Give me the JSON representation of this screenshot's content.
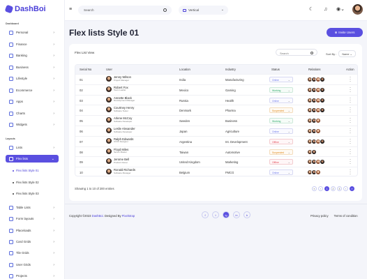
{
  "brand": {
    "name": "DashBoi"
  },
  "sidebar": {
    "section_dashboard": "Dashboard",
    "section_layouts": "Layouts",
    "items_top": [
      "Personal",
      "Finance",
      "Banking",
      "Business",
      "Lifestyle",
      "Ecommerce",
      "Apps",
      "Charts",
      "Widgets"
    ],
    "items_layout": [
      "Lists",
      "Flex lists",
      "Table Lists",
      "Form layouts",
      "Placeloads",
      "Card Grids",
      "Tile Grids",
      "User Grids",
      "Projects"
    ],
    "sub_items": [
      "Flex lists Style 01",
      "Flex lists Style 02",
      "Flex lists Style 03"
    ]
  },
  "topbar": {
    "search_placeholder": "Search",
    "layout_value": "Vertical"
  },
  "page": {
    "title": "Flex lists Style 01",
    "invite_label": "Invite Users"
  },
  "card": {
    "title": "Flex List View",
    "search_placeholder": "Search",
    "sort_label": "Sort By :",
    "sort_value": "Name"
  },
  "table": {
    "headers": [
      "Serial No",
      "User",
      "Location",
      "Industry",
      "Status",
      "Relations",
      "Action"
    ],
    "rows": [
      {
        "serial": "01",
        "name": "Jenny Wilson",
        "role": "Project Manager",
        "location": "India",
        "industry": "Manufacturing",
        "status": "Online",
        "status_type": "online"
      },
      {
        "serial": "02",
        "name": "Robert Fox",
        "role": "Team Leader",
        "location": "Mexico",
        "industry": "Gaming",
        "status": "Working",
        "status_type": "working"
      },
      {
        "serial": "03",
        "name": "Annette Black",
        "role": "Development Manager",
        "location": "Russia",
        "industry": "Health",
        "status": "Online",
        "status_type": "online"
      },
      {
        "serial": "04",
        "name": "Courtney Henry",
        "role": "Software Tester",
        "location": "Denmark",
        "industry": "Pharma",
        "status": "Suspended",
        "status_type": "suspended"
      },
      {
        "serial": "05",
        "name": "Arlene McCoy",
        "role": "Software Developer",
        "location": "Sweden",
        "industry": "Business",
        "status": "Working",
        "status_type": "working"
      },
      {
        "serial": "06",
        "name": "Leslie Alexander",
        "role": "Software Developer",
        "location": "Japan",
        "industry": "Agriculture",
        "status": "Online",
        "status_type": "online"
      },
      {
        "serial": "07",
        "name": "Ralph Edwards",
        "role": "UI/UX Designer",
        "location": "Argentina",
        "industry": "Int. Development",
        "status": "Offline",
        "status_type": "offline"
      },
      {
        "serial": "08",
        "name": "Floyd Miles",
        "role": "Server Master",
        "location": "Taiwan",
        "industry": "Automotive",
        "status": "Suspended",
        "status_type": "suspended"
      },
      {
        "serial": "09",
        "name": "Jerome Bell",
        "role": "Product Owner",
        "location": "United Kingdom",
        "industry": "Marketing",
        "status": "Offline",
        "status_type": "offline"
      },
      {
        "serial": "10",
        "name": "Ronald Richards",
        "role": "Software Manager",
        "location": "Belgium",
        "industry": "FMCG",
        "status": "Online",
        "status_type": "online"
      }
    ],
    "relations_counts": [
      4,
      4,
      4,
      4,
      3,
      3,
      4,
      2,
      4,
      3
    ],
    "showing": "Showing 1 to 10 of 200 entries",
    "pagination": [
      "«",
      "‹",
      "1",
      "2",
      "3",
      "›",
      "»"
    ]
  },
  "footer": {
    "copyright": "Copyright ©2023",
    "brand": "DashBoi.",
    "designed_by": "Designed By",
    "designer": "Pixelstrap",
    "links": [
      "Privacy policy",
      "Terms of condition"
    ],
    "social": [
      "f",
      "t",
      "ig",
      "in",
      "b"
    ]
  },
  "colors": {
    "accent": "#5a4fe0",
    "online": "#6b76e8",
    "working": "#2ea96a",
    "suspended": "#e08a1e",
    "offline": "#e24a58"
  }
}
